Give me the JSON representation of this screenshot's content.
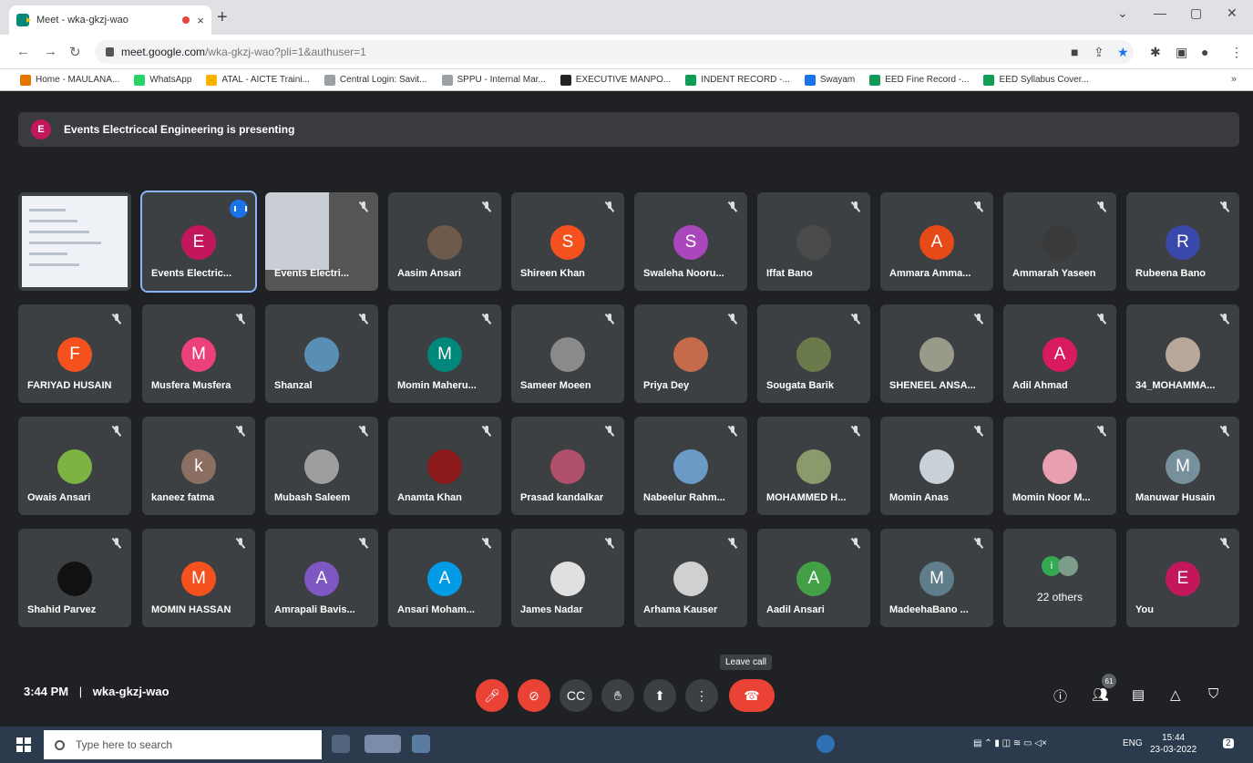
{
  "browser": {
    "tab_title": "Meet - wka-gkzj-wao",
    "tab_close": "×",
    "new_tab": "+",
    "window_controls": [
      "⌄",
      "—",
      "▢",
      "✕"
    ],
    "url_host": "meet.google.com",
    "url_path": "/wka-gkzj-wao?pli=1&authuser=1",
    "bookmarks": [
      {
        "label": "Home - MAULANA...",
        "color": "#e37400"
      },
      {
        "label": "WhatsApp",
        "color": "#25d366"
      },
      {
        "label": "ATAL - AICTE Traini...",
        "color": "#f4b400"
      },
      {
        "label": "Central Login: Savit...",
        "color": "#9aa0a6"
      },
      {
        "label": "SPPU - Internal Mar...",
        "color": "#9aa0a6"
      },
      {
        "label": "EXECUTIVE MANPO...",
        "color": "#202124"
      },
      {
        "label": "INDENT RECORD -...",
        "color": "#0f9d58"
      },
      {
        "label": "Swayam",
        "color": "#1a73e8"
      },
      {
        "label": "EED Fine Record -...",
        "color": "#0f9d58"
      },
      {
        "label": "EED Syllabus Cover...",
        "color": "#0f9d58"
      }
    ],
    "bookmarks_more": "»"
  },
  "meet": {
    "presenting_initial": "E",
    "presenting_text": "Events Electriccal Engineering is presenting",
    "time": "3:44 PM",
    "separator": "|",
    "meeting_code": "wka-gkzj-wao",
    "leave_tooltip": "Leave call",
    "people_count": "61",
    "others_initial": "i",
    "others_label": "22 others",
    "participants": [
      {
        "name": "",
        "type": "screen",
        "muted": false
      },
      {
        "name": "Events Electric...",
        "initial": "E",
        "color": "#c2185b",
        "type": "avatar",
        "speaking": true
      },
      {
        "name": "Events Electri...",
        "type": "video",
        "muted": true
      },
      {
        "name": "Aasim Ansari",
        "initial": "",
        "color": "#6d5a4a",
        "type": "photo",
        "muted": true
      },
      {
        "name": "Shireen Khan",
        "initial": "S",
        "color": "#f4511e",
        "type": "avatar",
        "muted": true
      },
      {
        "name": "Swaleha Nooru...",
        "initial": "S",
        "color": "#ab47bc",
        "type": "avatar",
        "muted": true
      },
      {
        "name": "Iffat Bano",
        "initial": "",
        "color": "#4a4a4a",
        "type": "photo",
        "muted": true
      },
      {
        "name": "Ammara Amma...",
        "initial": "A",
        "color": "#e64a19",
        "type": "avatar",
        "muted": true
      },
      {
        "name": "Ammarah Yaseen",
        "initial": "",
        "color": "#3a3a3a",
        "type": "photo",
        "muted": true
      },
      {
        "name": "Rubeena Bano",
        "initial": "R",
        "color": "#3949ab",
        "type": "avatar",
        "muted": true
      },
      {
        "name": "FARIYAD HUSAIN",
        "initial": "F",
        "color": "#f4511e",
        "type": "avatar",
        "muted": true
      },
      {
        "name": "Musfera Musfera",
        "initial": "M",
        "color": "#ec407a",
        "type": "avatar",
        "muted": true
      },
      {
        "name": "Shanzal",
        "initial": "",
        "color": "#5a8fb5",
        "type": "photo",
        "muted": true
      },
      {
        "name": "Momin Maheru...",
        "initial": "M",
        "color": "#00897b",
        "type": "avatar",
        "muted": true
      },
      {
        "name": "Sameer Moeen",
        "initial": "",
        "color": "#8a8a8a",
        "type": "photo",
        "muted": true
      },
      {
        "name": "Priya Dey",
        "initial": "",
        "color": "#c56a4a",
        "type": "photo",
        "muted": true
      },
      {
        "name": "Sougata Barik",
        "initial": "",
        "color": "#6b7a4a",
        "type": "photo",
        "muted": true
      },
      {
        "name": "SHENEEL ANSA...",
        "initial": "",
        "color": "#9a9a8a",
        "type": "photo",
        "muted": true
      },
      {
        "name": "Adil Ahmad",
        "initial": "A",
        "color": "#d81b60",
        "type": "avatar",
        "muted": true
      },
      {
        "name": "34_MOHAMMA...",
        "initial": "",
        "color": "#b8a89a",
        "type": "photo",
        "muted": true
      },
      {
        "name": "Owais Ansari",
        "initial": "",
        "color": "#7cb342",
        "type": "photo",
        "muted": true
      },
      {
        "name": "kaneez fatma",
        "initial": "k",
        "color": "#8d6e63",
        "type": "avatar",
        "muted": true
      },
      {
        "name": "Mubash Saleem",
        "initial": "",
        "color": "#9e9e9e",
        "type": "photo",
        "muted": true
      },
      {
        "name": "Anamta Khan",
        "initial": "",
        "color": "#8b1a1a",
        "type": "photo",
        "muted": true
      },
      {
        "name": "Prasad kandalkar",
        "initial": "",
        "color": "#b0506a",
        "type": "photo",
        "muted": true
      },
      {
        "name": "Nabeelur Rahm...",
        "initial": "",
        "color": "#6a9ac5",
        "type": "photo",
        "muted": true
      },
      {
        "name": "MOHAMMED H...",
        "initial": "",
        "color": "#8a9a6a",
        "type": "photo",
        "muted": true
      },
      {
        "name": "Momin Anas",
        "initial": "",
        "color": "#c8d0d8",
        "type": "photo",
        "muted": true
      },
      {
        "name": "Momin Noor M...",
        "initial": "",
        "color": "#e8a0b0",
        "type": "photo",
        "muted": true
      },
      {
        "name": "Manuwar Husain",
        "initial": "M",
        "color": "#78909c",
        "type": "avatar",
        "muted": true
      },
      {
        "name": "Shahid Parvez",
        "initial": "",
        "color": "#111111",
        "type": "photo",
        "muted": true
      },
      {
        "name": "MOMIN HASSAN",
        "initial": "M",
        "color": "#f4511e",
        "type": "avatar",
        "muted": true
      },
      {
        "name": "Amrapali Bavis...",
        "initial": "A",
        "color": "#7e57c2",
        "type": "avatar",
        "muted": true
      },
      {
        "name": "Ansari Moham...",
        "initial": "A",
        "color": "#039be5",
        "type": "avatar",
        "muted": true
      },
      {
        "name": "James Nadar",
        "initial": "",
        "color": "#e0e0e0",
        "type": "photo",
        "muted": true
      },
      {
        "name": "Arhama Kauser",
        "initial": "",
        "color": "#d0d0d0",
        "type": "photo",
        "muted": true
      },
      {
        "name": "Aadil Ansari",
        "initial": "A",
        "color": "#43a047",
        "type": "avatar",
        "muted": true
      },
      {
        "name": "MadeehaBano ...",
        "initial": "M",
        "color": "#607d8b",
        "type": "avatar",
        "muted": true
      },
      {
        "name": "22 others",
        "type": "others"
      },
      {
        "name": "You",
        "initial": "E",
        "color": "#c2185b",
        "type": "avatar",
        "muted": true
      }
    ]
  },
  "taskbar": {
    "search_placeholder": "Type here to search",
    "lang": "ENG",
    "time": "15:44",
    "date": "23-03-2022",
    "notif_count": "2"
  }
}
